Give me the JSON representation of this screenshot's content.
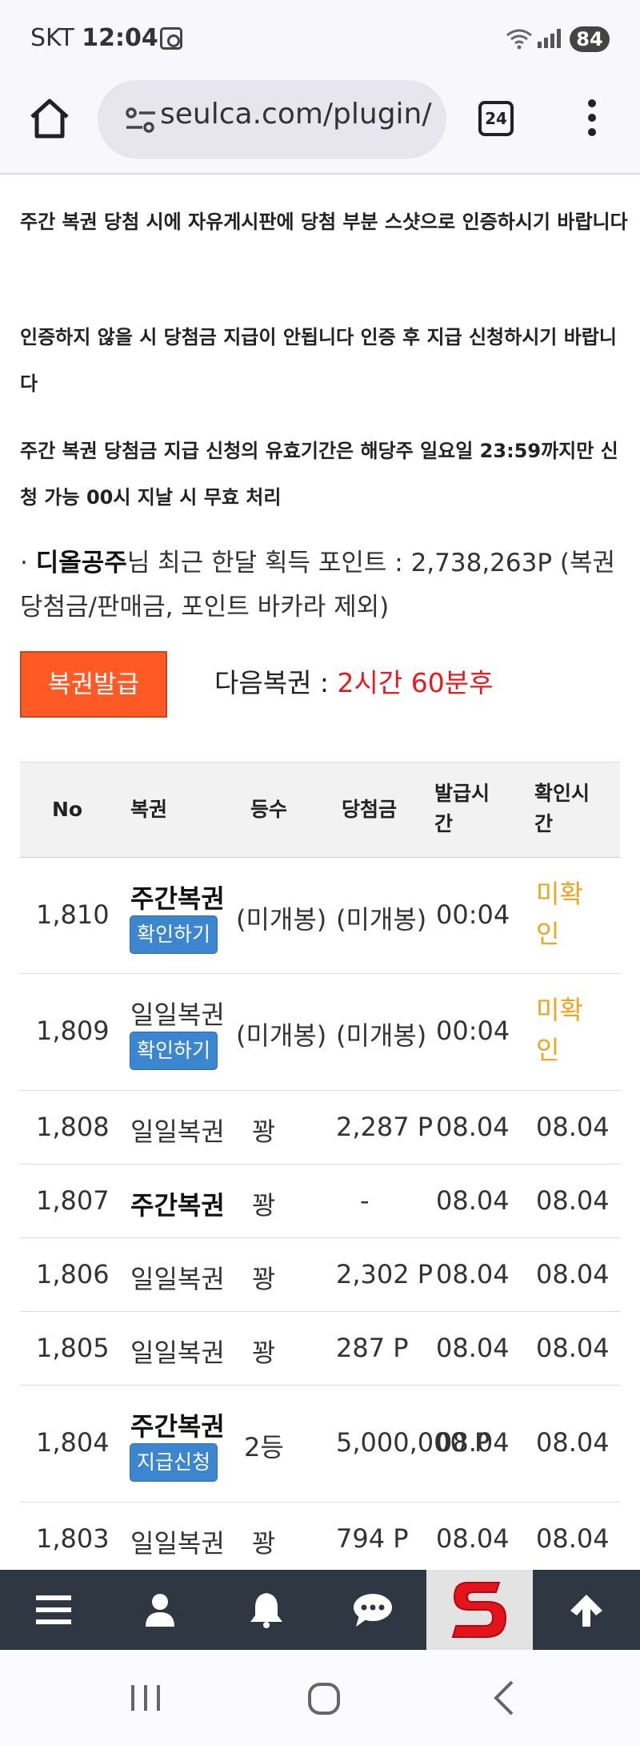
{
  "status_bar": {
    "carrier": "SKT",
    "time": "12:04",
    "battery": "84"
  },
  "browser": {
    "url": "seulca.com/plugin/",
    "tab_count": "24"
  },
  "notices": [
    "주간 복권 당첨 시에 자유게시판에 당첨 부분 스샷으로 인증하시기 바랍니다",
    "인증하지 않을 시 당첨금 지급이 안됩니다 인증 후 지급 신청하시기 바랍니다",
    "주간 복권 당첨금 지급 신청의 유효기간은 해당주 일요일 23:59까지만 신청 가능 00시 지날 시 무효 처리"
  ],
  "points": {
    "bullet": "·",
    "username": "디올공주",
    "text": "님 최근 한달 획득 포인트 : 2,738,263P (복권 당첨금/판매금, 포인트 바카라 제외)"
  },
  "issue_button": "복권발급",
  "next_lottery": {
    "label": "다음복권 : ",
    "value": "2시간 60분후"
  },
  "table": {
    "headers": [
      "No",
      "복권",
      "등수",
      "당첨금",
      "발급시간",
      "확인시간"
    ],
    "rows": [
      {
        "no": "1,810",
        "type": "주간복권",
        "type_bold": true,
        "action": "확인하기",
        "rank": "(미개봉)",
        "prize": "(미개봉)",
        "issued": "00:04",
        "checked": "미확인"
      },
      {
        "no": "1,809",
        "type": "일일복권",
        "type_bold": false,
        "action": "확인하기",
        "rank": "(미개봉)",
        "prize": "(미개봉)",
        "issued": "00:04",
        "checked": "미확인"
      },
      {
        "no": "1,808",
        "type": "일일복권",
        "type_bold": false,
        "action": "",
        "rank": "꽝",
        "prize": "2,287 P",
        "issued": "08.04",
        "checked": "08.04"
      },
      {
        "no": "1,807",
        "type": "주간복권",
        "type_bold": true,
        "action": "",
        "rank": "꽝",
        "prize": "-",
        "issued": "08.04",
        "checked": "08.04"
      },
      {
        "no": "1,806",
        "type": "일일복권",
        "type_bold": false,
        "action": "",
        "rank": "꽝",
        "prize": "2,302 P",
        "issued": "08.04",
        "checked": "08.04"
      },
      {
        "no": "1,805",
        "type": "일일복권",
        "type_bold": false,
        "action": "",
        "rank": "꽝",
        "prize": "287 P",
        "issued": "08.04",
        "checked": "08.04"
      },
      {
        "no": "1,804",
        "type": "주간복권",
        "type_bold": true,
        "action": "지급신청",
        "rank": "2등",
        "prize": "5,000,000 P",
        "issued": "08.04",
        "checked": "08.04"
      },
      {
        "no": "1,803",
        "type": "일일복권",
        "type_bold": false,
        "action": "",
        "rank": "꽝",
        "prize": "794 P",
        "issued": "08.04",
        "checked": "08.04"
      }
    ]
  },
  "bottom_nav": {
    "items": [
      "menu-icon",
      "user-icon",
      "bell-icon",
      "chat-icon",
      "site-logo",
      "arrow-up-icon"
    ],
    "logo_letter": "S"
  },
  "colors": {
    "accent_orange": "#ff5a25",
    "countdown_red": "#e8191f",
    "pill_blue": "#3c86d0",
    "unconfirmed_orange": "#f0a31c",
    "bottom_nav_bg": "#2f3842"
  }
}
